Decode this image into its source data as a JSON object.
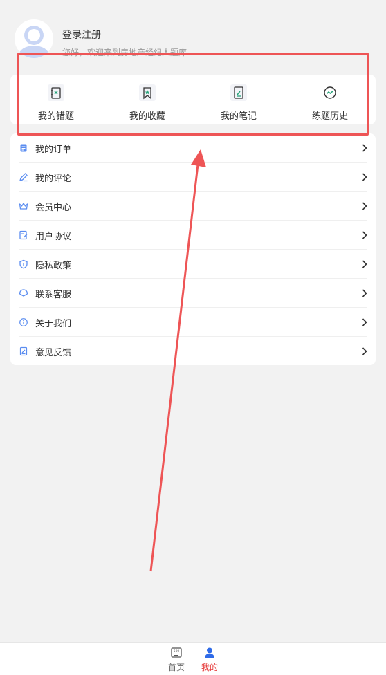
{
  "profile": {
    "login_label": "登录注册",
    "welcome_text": "您好，欢迎来到房地产经纪人题库",
    "avatar_icon": "user-avatar-icon"
  },
  "quick_actions": [
    {
      "label": "我的错题",
      "icon": "wrong-questions-icon"
    },
    {
      "label": "我的收藏",
      "icon": "bookmark-icon"
    },
    {
      "label": "我的笔记",
      "icon": "note-edit-icon"
    },
    {
      "label": "练题历史",
      "icon": "history-chart-icon"
    }
  ],
  "menu": [
    {
      "label": "我的订单",
      "icon": "order-document-icon"
    },
    {
      "label": "我的评论",
      "icon": "comment-pen-icon"
    },
    {
      "label": "会员中心",
      "icon": "crown-icon"
    },
    {
      "label": "用户协议",
      "icon": "agreement-icon"
    },
    {
      "label": "隐私政策",
      "icon": "shield-icon"
    },
    {
      "label": "联系客服",
      "icon": "customer-service-icon"
    },
    {
      "label": "关于我们",
      "icon": "info-icon"
    },
    {
      "label": "意见反馈",
      "icon": "feedback-icon"
    }
  ],
  "tabbar": {
    "home_label": "首页",
    "home_icon": "home-book-icon",
    "mine_label": "我的",
    "mine_icon": "person-icon"
  },
  "colors": {
    "accent_blue": "#2f6be8",
    "active_tab_red": "#e63b3b",
    "annotation_red": "#ee5556",
    "icon_green": "#27a27a",
    "background": "#f2f2f2"
  }
}
